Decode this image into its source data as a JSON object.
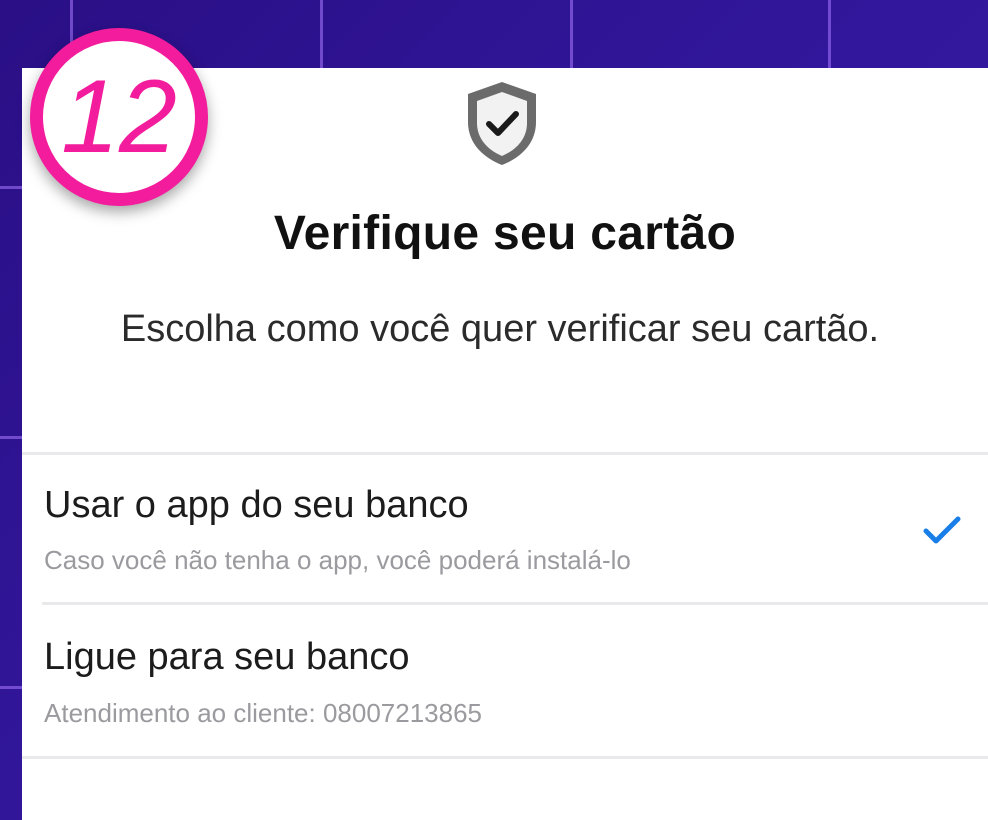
{
  "step_badge": "12",
  "header": {
    "icon": "shield-check-icon",
    "title": "Verifique seu cartão",
    "subtitle": "Escolha como você quer verificar seu cartão."
  },
  "options": [
    {
      "title": "Usar o app do seu banco",
      "subtitle": "Caso você não tenha o app, você poderá instalá-lo",
      "selected": true
    },
    {
      "title": "Ligue para seu banco",
      "subtitle": "Atendimento ao cliente: 08007213865",
      "selected": false
    }
  ],
  "colors": {
    "background": "#2f1496",
    "badge": "#f21c9c",
    "check": "#1a7ee8"
  }
}
